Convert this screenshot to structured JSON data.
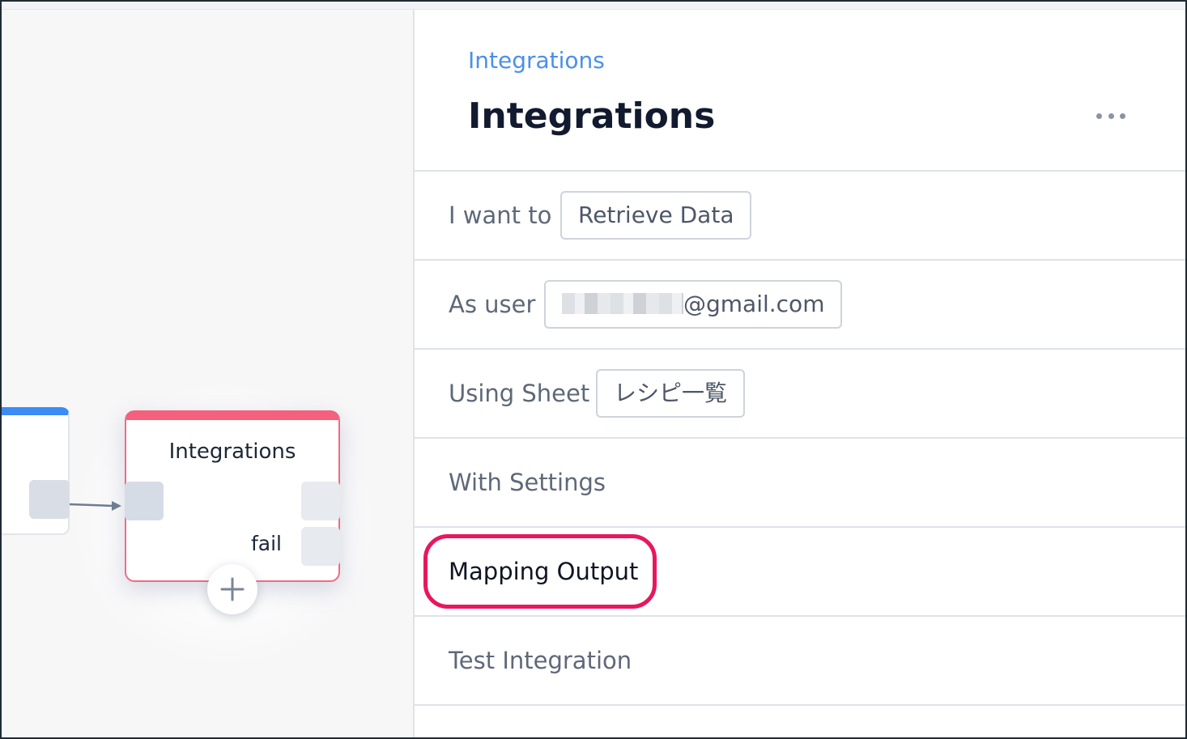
{
  "canvas": {
    "node": {
      "title": "Integrations",
      "fail_label": "fail"
    }
  },
  "panel": {
    "breadcrumb": "Integrations",
    "title": "Integrations",
    "rows": {
      "want": {
        "label": "I want to",
        "value": "Retrieve Data"
      },
      "user": {
        "label": "As user",
        "value_suffix": "@gmail.com"
      },
      "sheet": {
        "label": "Using Sheet",
        "value": "レシピ一覧"
      },
      "settings": {
        "label": "With Settings"
      },
      "mapping": {
        "label": "Mapping Output"
      },
      "test": {
        "label": "Test Integration"
      }
    }
  },
  "colors": {
    "accent_link": "#4a90e8",
    "node_header": "#f4607e",
    "prev_node_header": "#3b8cf5",
    "highlight": "#e8175d"
  },
  "icons": {
    "more": "more-horizontal-icon",
    "add": "plus-icon"
  }
}
